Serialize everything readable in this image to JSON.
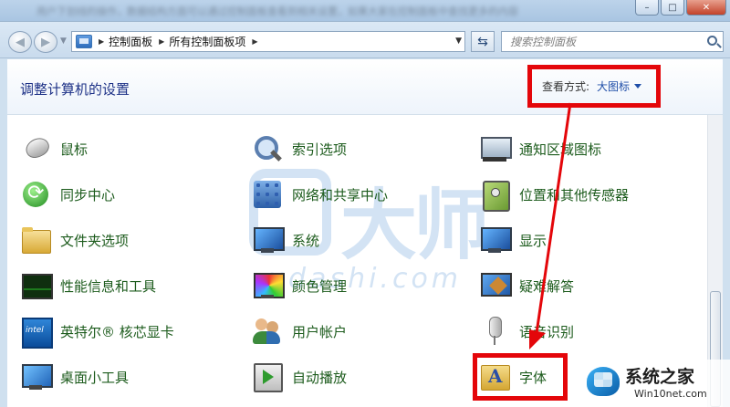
{
  "window": {
    "background_text": "用户下划线的操作，数据结构方面可以通过控制面板查看到相关设置，如果大家在控制面板中查找更多的内容",
    "controls": {
      "minimize": "–",
      "maximize": "□",
      "close": "✕"
    }
  },
  "navigation": {
    "breadcrumb": [
      "控制面板",
      "所有控制面板项"
    ],
    "search_placeholder": "搜索控制面板"
  },
  "header": {
    "title": "调整计算机的设置",
    "view_by_label": "查看方式:",
    "view_by_value": "大图标"
  },
  "items": [
    {
      "label": "鼠标",
      "icon": "mouse-icon"
    },
    {
      "label": "索引选项",
      "icon": "indexing-icon"
    },
    {
      "label": "通知区域图标",
      "icon": "notification-icon"
    },
    {
      "label": "同步中心",
      "icon": "sync-icon"
    },
    {
      "label": "网络和共享中心",
      "icon": "network-icon"
    },
    {
      "label": "位置和其他传感器",
      "icon": "location-sensor-icon"
    },
    {
      "label": "文件夹选项",
      "icon": "folder-icon"
    },
    {
      "label": "系统",
      "icon": "system-icon"
    },
    {
      "label": "显示",
      "icon": "display-icon"
    },
    {
      "label": "性能信息和工具",
      "icon": "performance-icon"
    },
    {
      "label": "颜色管理",
      "icon": "color-management-icon"
    },
    {
      "label": "疑难解答",
      "icon": "troubleshooting-icon"
    },
    {
      "label": "英特尔® 核芯显卡",
      "icon": "intel-graphics-icon"
    },
    {
      "label": "用户帐户",
      "icon": "user-accounts-icon"
    },
    {
      "label": "语音识别",
      "icon": "speech-recognition-icon"
    },
    {
      "label": "桌面小工具",
      "icon": "desktop-gadgets-icon"
    },
    {
      "label": "自动播放",
      "icon": "autoplay-icon"
    },
    {
      "label": "字体",
      "icon": "fonts-icon"
    }
  ],
  "watermark": {
    "text": "大师",
    "url": "udashi.com"
  },
  "site_badge": {
    "title": "系统之家",
    "subtitle": "Win10net.com"
  },
  "colors": {
    "accent_red": "#e4060a",
    "link_blue": "#1f4ea8",
    "item_green": "#1c5b1c"
  }
}
